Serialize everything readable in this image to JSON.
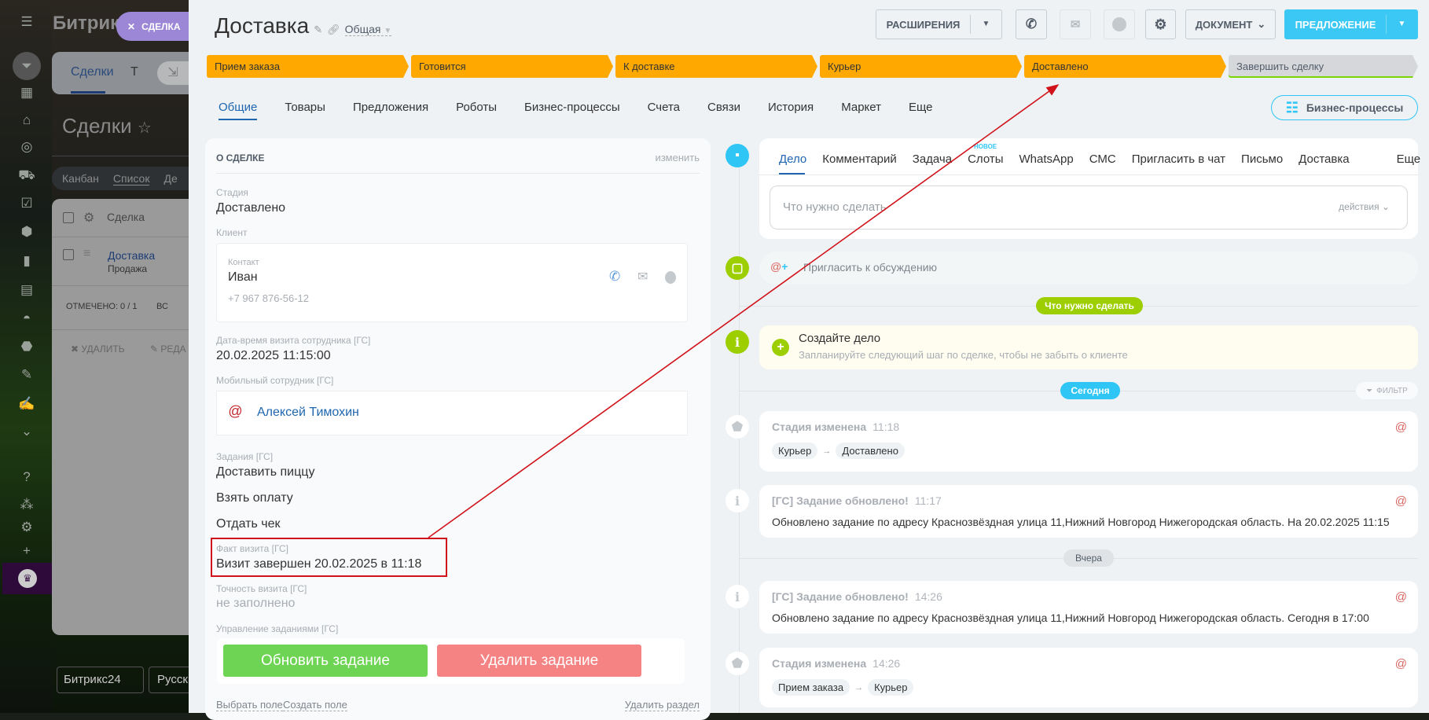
{
  "background": {
    "brand": "Битрикс",
    "close_badge": "СДЕЛКА",
    "tabs": [
      "Сделки",
      "Т"
    ],
    "page_title": "Сделки",
    "views": [
      "Канбан",
      "Список",
      "Де"
    ],
    "grid_header": "Сделка",
    "row": {
      "title": "Доставка",
      "subtitle": "Продажа"
    },
    "marked": "ОТМЕЧЕНО: 0 / 1",
    "marked_extra": "ВС",
    "actions": [
      "УДАЛИТЬ",
      "РЕДА"
    ],
    "footer": [
      "Битрикс24",
      "Русск"
    ]
  },
  "header": {
    "title": "Доставка",
    "category": "Общая",
    "extensions_label": "РАСШИРЕНИЯ",
    "document_label": "ДОКУМЕНТ",
    "offer_label": "ПРЕДЛОЖЕНИЕ"
  },
  "stages": [
    {
      "label": "Прием заказа",
      "color": "#ffa900"
    },
    {
      "label": "Готовится",
      "color": "#ffa900"
    },
    {
      "label": "К доставке",
      "color": "#ffa900"
    },
    {
      "label": "Курьер",
      "color": "#ffa900"
    },
    {
      "label": "Доставлено",
      "color": "#ffa900"
    },
    {
      "label": "Завершить сделку",
      "color": "#d5d7db"
    }
  ],
  "tabs": [
    "Общие",
    "Товары",
    "Предложения",
    "Роботы",
    "Бизнес-процессы",
    "Счета",
    "Связи",
    "История",
    "Маркет",
    "Еще"
  ],
  "bp_button": "Бизнес-процессы",
  "about": {
    "title": "О СДЕЛКЕ",
    "edit": "изменить",
    "stage_label": "Стадия",
    "stage_value": "Доставлено",
    "client_label": "Клиент",
    "contact_label": "Контакт",
    "contact_name": "Иван",
    "contact_phone": "+7 967 876-56-12",
    "visit_dt_label": "Дата-время визита сотрудника [ГС]",
    "visit_dt_value": "20.02.2025 11:15:00",
    "mobile_label": "Мобильный сотрудник [ГС]",
    "mobile_value": "Алексей Тимохин",
    "tasks_label": "Задания [ГС]",
    "tasks": [
      "Доставить пиццу",
      "Взять оплату",
      "Отдать чек"
    ],
    "fact_label": "Факт визита [ГС]",
    "fact_value": "Визит завершен 20.02.2025 в 11:18",
    "accuracy_label": "Точность визита [ГС]",
    "accuracy_value": "не заполнено",
    "manage_label": "Управление заданиями [ГС]",
    "update_btn": "Обновить задание",
    "delete_btn": "Удалить задание",
    "choose_field": "Выбрать поле",
    "create_field": "Создать поле",
    "delete_section": "Удалить раздел"
  },
  "timeline": {
    "tabs": [
      "Дело",
      "Комментарий",
      "Задача",
      "Слоты",
      "WhatsApp",
      "СМС",
      "Пригласить в чат",
      "Письмо",
      "Доставка",
      "Еще"
    ],
    "new_badge": "НОВОЕ",
    "composer_placeholder": "Что нужно сделать",
    "actions": "действия",
    "invite": "Пригласить к обсуждению",
    "todo_pill": "Что нужно сделать",
    "create_title": "Создайте дело",
    "create_sub": "Запланируйте следующий шаг по сделке, чтобы не забыть о клиенте",
    "today": "Сегодня",
    "filter": "ФИЛЬТР",
    "yesterday": "Вчера",
    "events": [
      {
        "title": "Стадия изменена",
        "time": "11:18",
        "from": "Курьер",
        "to": "Доставлено"
      },
      {
        "title": "[ГС] Задание обновлено!",
        "time": "11:17",
        "body": "Обновлено задание по адресу Краснозвёздная улица 11,Нижний Новгород Нижегородская область. На 20.02.2025 11:15"
      },
      {
        "title": "[ГС] Задание обновлено!",
        "time": "14:26",
        "body": "Обновлено задание по адресу Краснозвёздная улица 11,Нижний Новгород Нижегородская область. Сегодня в 17:00"
      },
      {
        "title": "Стадия изменена",
        "time": "14:26",
        "from": "Прием заказа",
        "to": "Курьер"
      }
    ]
  },
  "colors": {
    "accent": "#2fc6f6",
    "orange": "#ffa900",
    "green": "#9dcf00",
    "annotation": "#d0131b"
  }
}
